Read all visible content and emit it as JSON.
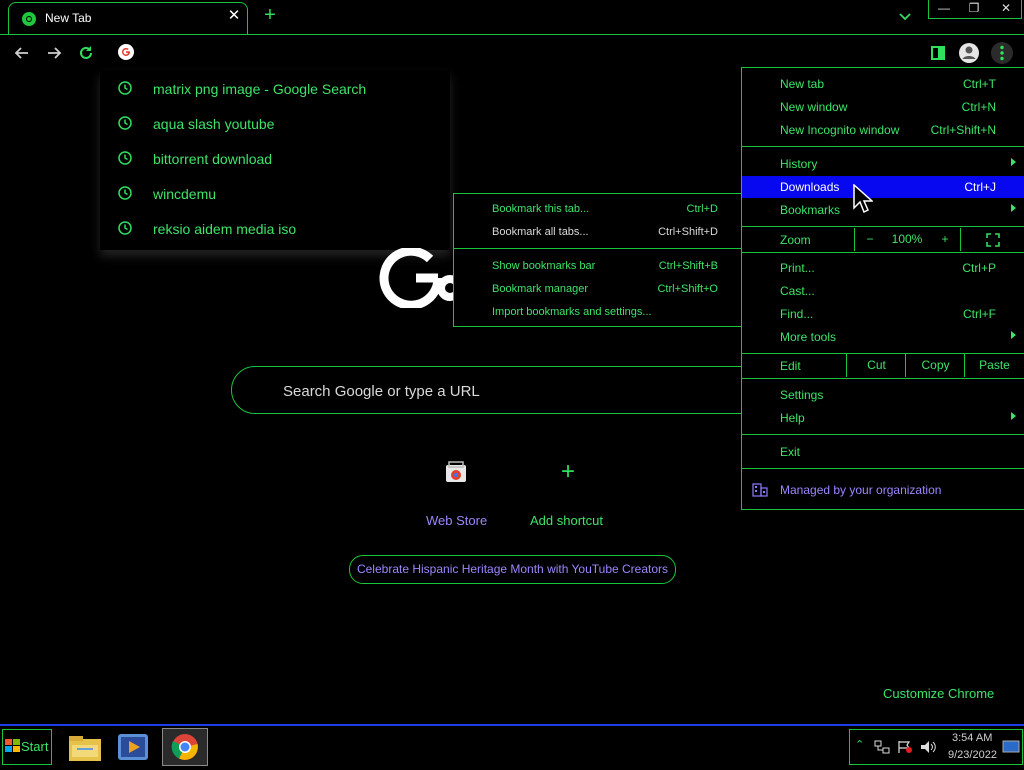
{
  "tab": {
    "title": "New Tab"
  },
  "window_controls": {
    "minimize": "—",
    "restore": "❐",
    "close": "✕"
  },
  "omnibox_suggestions": [
    "matrix png image - Google Search",
    "aqua slash youtube",
    "bittorrent download",
    "wincdemu",
    "reksio aidem media iso"
  ],
  "search": {
    "placeholder": "Search Google or type a URL"
  },
  "shortcuts": [
    {
      "label": "Web Store",
      "color": "#9e86ff"
    },
    {
      "label": "Add shortcut",
      "color": "#3ee468"
    }
  ],
  "promo": "Celebrate Hispanic Heritage Month with YouTube Creators",
  "customize": "Customize Chrome",
  "menu": {
    "new_tab": {
      "label": "New tab",
      "shortcut": "Ctrl+T"
    },
    "new_window": {
      "label": "New window",
      "shortcut": "Ctrl+N"
    },
    "new_incognito": {
      "label": "New Incognito window",
      "shortcut": "Ctrl+Shift+N"
    },
    "history": {
      "label": "History"
    },
    "downloads": {
      "label": "Downloads",
      "shortcut": "Ctrl+J"
    },
    "bookmarks": {
      "label": "Bookmarks"
    },
    "zoom": {
      "label": "Zoom",
      "minus": "−",
      "level": "100%",
      "plus": "+"
    },
    "print": {
      "label": "Print...",
      "shortcut": "Ctrl+P"
    },
    "cast": {
      "label": "Cast..."
    },
    "find": {
      "label": "Find...",
      "shortcut": "Ctrl+F"
    },
    "more_tools": {
      "label": "More tools"
    },
    "edit": {
      "label": "Edit",
      "cut": "Cut",
      "copy": "Copy",
      "paste": "Paste"
    },
    "settings": {
      "label": "Settings"
    },
    "help": {
      "label": "Help"
    },
    "exit": {
      "label": "Exit"
    },
    "managed": {
      "label": "Managed by your organization"
    }
  },
  "bookmarks_submenu": [
    {
      "label": "Bookmark this tab...",
      "shortcut": "Ctrl+D"
    },
    {
      "label": "Bookmark all tabs...",
      "shortcut": "Ctrl+Shift+D"
    },
    {
      "label": "Show bookmarks bar",
      "shortcut": "Ctrl+Shift+B"
    },
    {
      "label": "Bookmark manager",
      "shortcut": "Ctrl+Shift+O"
    },
    {
      "label": "Import bookmarks and settings...",
      "shortcut": ""
    }
  ],
  "taskbar": {
    "start": "Start",
    "time": "3:54 AM",
    "date": "9/23/2022"
  },
  "colors": {
    "accent": "#19c639",
    "highlight": "#0808f0",
    "link": "#9e86ff",
    "taskbar_border": "#1d3ce8"
  }
}
